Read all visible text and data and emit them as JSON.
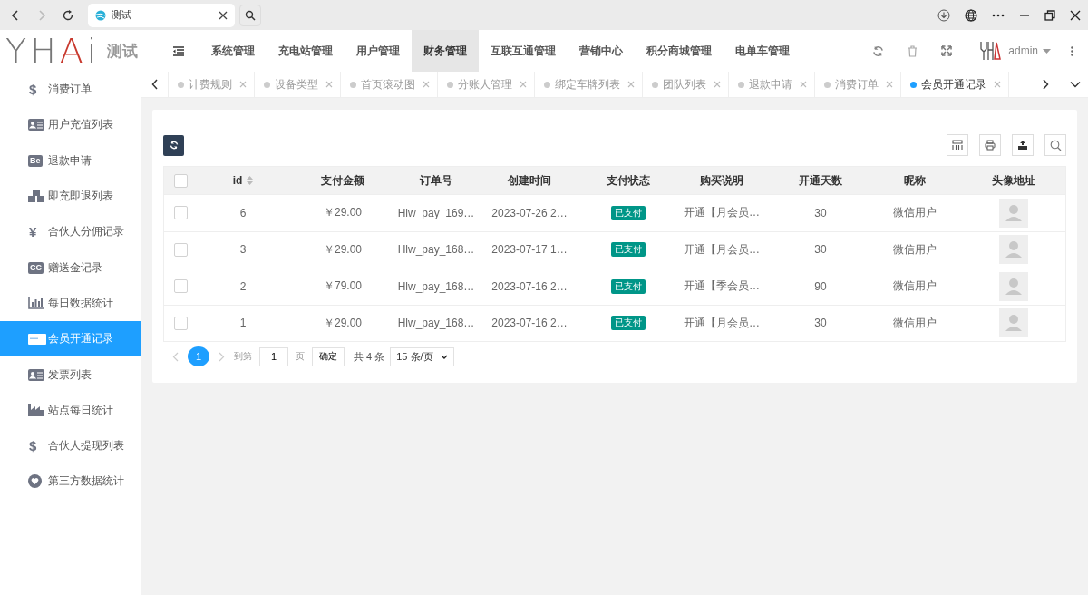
{
  "browser": {
    "tab_title": "测试"
  },
  "logo": {
    "mark": "YHAi",
    "name": "测试"
  },
  "nav": [
    {
      "label": "系统管理",
      "selected": false
    },
    {
      "label": "充电站管理",
      "selected": false
    },
    {
      "label": "用户管理",
      "selected": false
    },
    {
      "label": "财务管理",
      "selected": true
    },
    {
      "label": "互联互通管理",
      "selected": false
    },
    {
      "label": "营销中心",
      "selected": false
    },
    {
      "label": "积分商城管理",
      "selected": false
    },
    {
      "label": "电单车管理",
      "selected": false
    }
  ],
  "user": {
    "name": "admin"
  },
  "sidebar": {
    "items": [
      {
        "label": "消费订单",
        "kind": "glyph",
        "glyph": "$",
        "selected": false
      },
      {
        "label": "用户充值列表",
        "kind": "idcard",
        "selected": false
      },
      {
        "label": "退款申请",
        "kind": "boxed",
        "glyph": "Be",
        "selected": false
      },
      {
        "label": "即充即退列表",
        "kind": "cubes",
        "selected": false
      },
      {
        "label": "合伙人分佣记录",
        "kind": "glyph",
        "glyph": "¥",
        "selected": false
      },
      {
        "label": "赠送金记录",
        "kind": "boxed",
        "glyph": "CC",
        "selected": false
      },
      {
        "label": "每日数据统计",
        "kind": "chart",
        "selected": false
      },
      {
        "label": "会员开通记录",
        "kind": "card",
        "selected": true
      },
      {
        "label": "发票列表",
        "kind": "idcard",
        "selected": false
      },
      {
        "label": "站点每日统计",
        "kind": "industry",
        "selected": false
      },
      {
        "label": "合伙人提现列表",
        "kind": "glyph",
        "glyph": "$",
        "selected": false
      },
      {
        "label": "第三方数据统计",
        "kind": "heart",
        "selected": false
      }
    ]
  },
  "tabs": [
    {
      "label": "计费规则",
      "selected": false
    },
    {
      "label": "设备类型",
      "selected": false
    },
    {
      "label": "首页滚动图",
      "selected": false
    },
    {
      "label": "分账人管理",
      "selected": false
    },
    {
      "label": "绑定车牌列表",
      "selected": false
    },
    {
      "label": "团队列表",
      "selected": false
    },
    {
      "label": "退款申请",
      "selected": false
    },
    {
      "label": "消费订单",
      "selected": false
    },
    {
      "label": "会员开通记录",
      "selected": true
    }
  ],
  "table": {
    "select_all_checked": false,
    "columns": [
      "id",
      "支付金额",
      "订单号",
      "创建时间",
      "支付状态",
      "购买说明",
      "开通天数",
      "昵称",
      "头像地址"
    ],
    "rows": [
      {
        "checked": false,
        "id": "6",
        "amount": "￥29.00",
        "order_no": "Hlw_pay_169…",
        "created": "2023-07-26 2…",
        "status": "已支付",
        "description": "开通【月会员…",
        "days": "30",
        "nickname": "微信用户"
      },
      {
        "checked": false,
        "id": "3",
        "amount": "￥29.00",
        "order_no": "Hlw_pay_168…",
        "created": "2023-07-17 1…",
        "status": "已支付",
        "description": "开通【月会员…",
        "days": "30",
        "nickname": "微信用户"
      },
      {
        "checked": false,
        "id": "2",
        "amount": "￥79.00",
        "order_no": "Hlw_pay_168…",
        "created": "2023-07-16 2…",
        "status": "已支付",
        "description": "开通【季会员…",
        "days": "90",
        "nickname": "微信用户"
      },
      {
        "checked": false,
        "id": "1",
        "amount": "￥29.00",
        "order_no": "Hlw_pay_168…",
        "created": "2023-07-16 2…",
        "status": "已支付",
        "description": "开通【月会员…",
        "days": "30",
        "nickname": "微信用户"
      }
    ]
  },
  "pagination": {
    "pages": [
      {
        "label": "1",
        "selected": true
      }
    ],
    "goto_label": "到第",
    "goto_value": "1",
    "page_unit": "页",
    "confirm": "确定",
    "total": "共 4 条",
    "page_size": "15 条/页"
  }
}
